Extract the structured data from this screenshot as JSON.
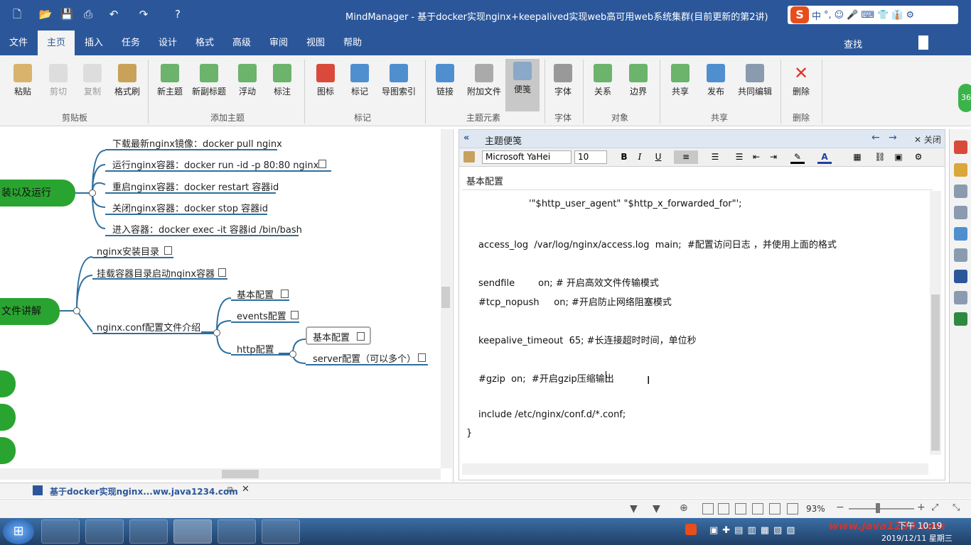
{
  "window": {
    "title": "MindManager - 基于docker实现nginx+keepalived实现web高可用web系统集群(目前更新的第2讲)"
  },
  "ime": {
    "logo": "S",
    "items": [
      "中",
      "°,",
      "☺",
      "🎤",
      "⌨",
      "👕",
      "👔",
      "⚙"
    ]
  },
  "ribbon_tabs": [
    "文件",
    "主页",
    "插入",
    "任务",
    "设计",
    "格式",
    "高级",
    "审阅",
    "视图",
    "帮助"
  ],
  "active_tab": "主页",
  "search_label": "查找",
  "ribbon": {
    "buttons": [
      "粘贴",
      "剪切",
      "复制",
      "格式刷",
      "新主题",
      "新副标题",
      "浮动",
      "标注",
      "图标",
      "标记",
      "导图索引",
      "链接",
      "附加文件",
      "便笺",
      "字体",
      "关系",
      "边界",
      "共享",
      "发布",
      "共同编辑",
      "删除"
    ],
    "groups": [
      "剪贴板",
      "添加主题",
      "标记",
      "主题元素",
      "字体",
      "对象",
      "共享",
      "删除"
    ]
  },
  "map": {
    "central_nodes": [
      "装以及运行",
      "文件讲解"
    ],
    "docker_items": [
      "下载最新nginx镜像：docker pull nginx",
      "运行nginx容器：docker run -id -p 80:80  nginx",
      "重启nginx容器：docker restart 容器id",
      "关闭nginx容器：docker stop 容器id",
      "进入容器：docker exec -it 容器id /bin/bash"
    ],
    "config_items": [
      "nginx安装目录",
      "挂载容器目录启动nginx容器",
      "nginx.conf配置文件介绍"
    ],
    "conf_sub": [
      "基本配置",
      "events配置",
      "http配置"
    ],
    "http_sub": [
      "基本配置",
      "server配置（可以多个）"
    ]
  },
  "notes": {
    "header": "主题便笺",
    "close_label": "关闭",
    "font_name": "Microsoft YaHei",
    "font_size": "10",
    "topic_title": "基本配置",
    "lines": [
      "'\"$http_user_agent\" \"$http_x_forwarded_for\"';",
      "",
      "access_log  /var/log/nginx/access.log  main;  #配置访问日志 ，并使用上面的格式",
      "",
      "sendfile        on; # 开启高效文件传输模式",
      "#tcp_nopush     on; #开启防止网络阻塞模式",
      "",
      "keepalive_timeout  65; #长连接超时时间，单位秒",
      "",
      "#gzip  on;  #开启gzip压缩输出",
      "",
      "include /etc/nginx/conf.d/*.conf;",
      "}"
    ]
  },
  "doc_tab": "基于docker实现nginx...ww.java1234.com",
  "zoom": "93%",
  "clock": {
    "time": "下午 10:19",
    "date": "2019/12/11 星期三"
  },
  "watermark": "www.java1234.com",
  "badge": "36"
}
